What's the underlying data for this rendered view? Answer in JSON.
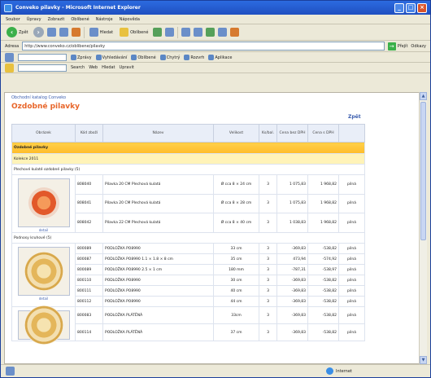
{
  "window": {
    "title": "Conveko pilavky - Microsoft Internet Explorer"
  },
  "menu": [
    "Soubor",
    "Úpravy",
    "Zobrazit",
    "Oblíbené",
    "Nástroje",
    "Nápověda"
  ],
  "toolbar": {
    "back": "Zpět",
    "search": "Hledat",
    "favorites": "Oblíbené"
  },
  "address": {
    "label": "Adresa",
    "value": "http://www.conveko.cz/oblibene/pilavky",
    "go": "Přejít",
    "links": "Odkazy"
  },
  "toolbar2": {
    "items": [
      "Zprávy",
      "Vyhledávání",
      "Oblíbené",
      "Chytrý",
      "Rozvrh",
      "Aplikace"
    ]
  },
  "toolbar3": {
    "items": [
      "Search",
      "Web",
      "Hledat",
      "Upravit"
    ]
  },
  "page": {
    "breadcrumb": "Obchodní katalog Conveko",
    "title": "Ozdobné pilavky",
    "back_link": "Zpět",
    "columns": [
      "Obrázek",
      "Kód zboží",
      "Název",
      "Velikost",
      "Ks/bal.",
      "Cena bez DPH",
      "Cena s DPH",
      ""
    ],
    "section_title": "Ozdobné pilavky",
    "sub_section": "Kolekce 2011",
    "groups": [
      {
        "head": "Plechové kulaté ozdobné pilavky (5)",
        "image_caption": "detail",
        "rows": [
          {
            "code": "808040",
            "name": "Pilavka 20 CM Plechová kulatá",
            "size": "Ø cca 8 × 24 cm",
            "qty": "3",
            "price": "1 075,83",
            "price_vat": "1 968,82",
            "unit": "pilná"
          },
          {
            "code": "808041",
            "name": "Pilavka 20 CM Plechová kulatá",
            "size": "Ø cca 8 × 28 cm",
            "qty": "3",
            "price": "1 075,83",
            "price_vat": "1 968,82",
            "unit": "pilná"
          },
          {
            "code": "808042",
            "name": "Pilavka 22 CM Plechová kulatá",
            "size": "Ø cca 8 × 40 cm",
            "qty": "3",
            "price": "1 038,83",
            "price_vat": "1 968,82",
            "unit": "pilná"
          }
        ]
      },
      {
        "head": "Podnosy kruhové (5)",
        "image_caption": "detail",
        "rows": [
          {
            "code": "800089",
            "name": "PODLOŽKA PO8990",
            "size": "33 cm",
            "qty": "3",
            "price": "-369,83",
            "price_vat": "-538,82",
            "unit": "pilná"
          },
          {
            "code": "800087",
            "name": "PODLOŽKA PO8990 1.1 × 1.8 × 8 cm",
            "size": "35 cm",
            "qty": "3",
            "price": "473,94",
            "price_vat": "-574,92",
            "unit": "pilná"
          },
          {
            "code": "800089",
            "name": "PODLOŽKA PO8990 2.5 × 1 cm",
            "size": "180 mm",
            "qty": "3",
            "price": "-787,31",
            "price_vat": "-538,97",
            "unit": "pilná"
          },
          {
            "code": "800110",
            "name": "PODLOŽKA PO8990",
            "size": "30 cm",
            "qty": "3",
            "price": "-369,83",
            "price_vat": "-538,82",
            "unit": "pilná"
          },
          {
            "code": "800111",
            "name": "PODLOŽKA PO8990",
            "size": "40 cm",
            "qty": "3",
            "price": "-369,83",
            "price_vat": "-538,82",
            "unit": "pilná"
          },
          {
            "code": "800112",
            "name": "PODLOŽKA PO8990",
            "size": "44 cm",
            "qty": "3",
            "price": "-369,83",
            "price_vat": "-538,82",
            "unit": "pilná"
          }
        ]
      },
      {
        "head": "",
        "image_caption": "",
        "rows": [
          {
            "code": "800083",
            "name": "PODLOŽKA PLÁTĚNÁ",
            "size": "33cm",
            "qty": "3",
            "price": "-369,83",
            "price_vat": "-538,82",
            "unit": "pilná"
          },
          {
            "code": "800114",
            "name": "PODLOŽKA PLÁTĚNÁ",
            "size": "37 cm",
            "qty": "3",
            "price": "-369,83",
            "price_vat": "-538,82",
            "unit": "pilná"
          }
        ]
      }
    ]
  },
  "status": {
    "zone": "Internet"
  }
}
